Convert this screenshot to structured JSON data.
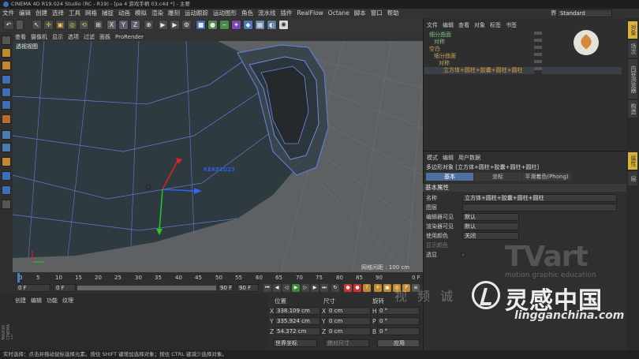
{
  "app": {
    "title": "CINEMA 4D R19.024 Studio (RC - R19) - [pa 4 游戏手柄 03.c4d *] - 主要",
    "layout_label": "界面:",
    "layout_value": "Standard"
  },
  "menubar": [
    "文件",
    "编辑",
    "创建",
    "选择",
    "工具",
    "网格",
    "捕捉",
    "动画",
    "模拟",
    "渲染",
    "雕刻",
    "运动跟踪",
    "运动图形",
    "角色",
    "流水线",
    "插件",
    "RealFlow",
    "Octane",
    "脚本",
    "窗口",
    "帮助"
  ],
  "toolbar": {
    "undo": "↶",
    "axis_x": "X",
    "axis_y": "Y",
    "axis_z": "Z"
  },
  "viewport": {
    "menu": [
      "查看",
      "摄像机",
      "显示",
      "选项",
      "过滤",
      "面板",
      "ProRender"
    ],
    "view_label": "透视视图",
    "overlay_text": "KEKE2023",
    "grid_info": "网格间距 : 100 cm",
    "colors": {
      "background": "#5d6163",
      "model": "#2f3940",
      "wire": "#5b7fd0"
    }
  },
  "timeline": {
    "ticks": [
      "0",
      "5",
      "10",
      "15",
      "20",
      "25",
      "30",
      "35",
      "40",
      "45",
      "50",
      "55",
      "60",
      "65",
      "70",
      "75",
      "80",
      "85",
      "90"
    ],
    "end_frame_label": "0 F"
  },
  "playbar": {
    "current_frame": "0 F",
    "start_frame": "0 F",
    "end_frame": "90 F",
    "end_frame2": "90 F"
  },
  "material_manager": {
    "menu": [
      "创建",
      "编辑",
      "功能",
      "纹理"
    ]
  },
  "coordinates": {
    "headers": [
      "位置",
      "尺寸",
      "旋转"
    ],
    "rows": [
      {
        "axis": "X",
        "pos": "338.109 cm",
        "size_axis": "X",
        "size": "0 cm",
        "rot_axis": "H",
        "rot": "0 °"
      },
      {
        "axis": "Y",
        "pos": "335.924 cm",
        "size_axis": "Y",
        "size": "0 cm",
        "rot_axis": "P",
        "rot": "0 °"
      },
      {
        "axis": "Z",
        "pos": "54.372 cm",
        "size_axis": "Z",
        "size": "0 cm",
        "rot_axis": "B",
        "rot": "0 °"
      }
    ],
    "coord_system": "世界坐标",
    "size_mode": "绝对尺寸",
    "apply_label": "应用"
  },
  "object_manager": {
    "menu": [
      "文件",
      "编辑",
      "查看",
      "对象",
      "标签",
      "书签"
    ],
    "objects": [
      {
        "name": "细分曲面",
        "color": "#7ec27e"
      },
      {
        "name": "对称",
        "color": "#7ec27e"
      },
      {
        "name": "空白",
        "color": "#c9a25b"
      },
      {
        "name": "细分曲面",
        "color": "#c9a25b"
      },
      {
        "name": "对称",
        "color": "#c9a25b"
      },
      {
        "name": "立方体+圆柱+胶囊+圆柱+圆柱",
        "color": "#e0a030"
      }
    ]
  },
  "attribute_manager": {
    "menu": [
      "模式",
      "编辑",
      "用户数据"
    ],
    "object_type": "多边形对象 [立方体+圆柱+胶囊+圆柱+圆柱]",
    "tabs": [
      "基本",
      "坐标",
      "平滑着色(Phong)"
    ],
    "section": "基本属性",
    "fields": [
      {
        "label": "名称",
        "value": "立方体+圆柱+胶囊+圆柱+圆柱"
      },
      {
        "label": "图层",
        "value": ""
      },
      {
        "label": "编辑器可见",
        "value": "默认"
      },
      {
        "label": "渲染器可见",
        "value": "默认"
      },
      {
        "label": "使用颜色",
        "value": "关闭"
      },
      {
        "label": "显示颜色",
        "value": ""
      },
      {
        "label": "透显",
        "value": ""
      }
    ]
  },
  "right_tabs": [
    "对象",
    "场次",
    "内容浏览器",
    "构造"
  ],
  "right_tabs_lower": [
    "属性",
    "层"
  ],
  "status": "实时选择：点击并拖动鼠标选择元素。按住 SHIFT 键增加选择对象；按住 CTRL 键减少选择对象。",
  "watermark": {
    "tvart": "TVart",
    "tvart_sub": "motion graphic education",
    "video": "视 频 诚",
    "brand_cn": "灵感中国",
    "url": "lingganchina.com"
  },
  "left_vertical_text": "MAXON CINEMA 4D"
}
